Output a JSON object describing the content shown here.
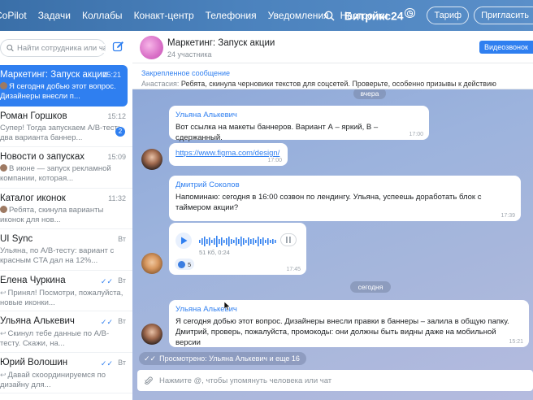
{
  "nav": {
    "items": [
      "CoPilot",
      "Задачи",
      "Коллабы",
      "Конакт-центр",
      "Телефония",
      "Уведомления",
      "Настройки"
    ],
    "logo": "Битрикс24",
    "tariff": "Тариф",
    "invite": "Пригласить"
  },
  "sidebar": {
    "search_placeholder": "Найти сотрудника или чат",
    "chats": [
      {
        "name": "Маркетинг: Запуск акции",
        "time": "15:21",
        "preview": "Я сегодня добью этот вопрос. Дизайнеры внесли п..."
      },
      {
        "name": "Роман Горшков",
        "time": "15:12",
        "preview": "Супер! Тогда запускаем A/B-тест: два варианта баннер...",
        "badge": "2"
      },
      {
        "name": "Новости о запусках",
        "time": "15:09",
        "preview": "В июне — запуск рекламной компании, которая..."
      },
      {
        "name": "Каталог иконок",
        "time": "11:32",
        "preview": "Ребята, скинула варианты иконок для нов..."
      },
      {
        "name": "UI Sync",
        "time": "Вт",
        "preview": "Ульяна, по A/B-тесту: вариант с красным CTA дал на 12%..."
      },
      {
        "name": "Елена Чуркина",
        "time": "Вт",
        "preview": "Принял! Посмотри, пожалуйста, новые иконки..."
      },
      {
        "name": "Ульяна Алькевич",
        "time": "Вт",
        "preview": "Скинул тебе данные по A/B-тесту. Скажи, на..."
      },
      {
        "name": "Юрий Волошин",
        "time": "Вт",
        "preview": "Давай скоординируемся по дизайну для..."
      }
    ]
  },
  "header": {
    "title": "Маркетинг: Запуск акции",
    "members": "24 участника",
    "video_call": "Видеозвонок"
  },
  "pinned": {
    "title": "Закрепленное сообщение",
    "author": "Анастасия:",
    "text": "Ребята, скинула черновики текстов для соцсетей. Проверьте, особенно призывы к действию"
  },
  "messages": {
    "date_yesterday": "вчера",
    "date_today": "сегодня",
    "m1_author": "Ульяна Алькевич",
    "m1_text": "Вот ссылка на макеты баннеров. Вариант А – яркий, В – сдержанный.",
    "m1_time": "17:00",
    "m2_link": "https://www.figma.com/design/",
    "m2_time": "17:00",
    "m3_author": "Дмитрий Соколов",
    "m3_text": "Напоминаю: сегодня в 16:00 созвон по лендингу. Ульяна, успеешь доработать блок с таймером акции?",
    "m3_time": "17:39",
    "audio_meta": "51 Кб,  0:24",
    "audio_reactions": "5",
    "audio_time": "17:45",
    "m4_author": "Ульяна Алькевич",
    "m4_text": "Я сегодня добью этот вопрос. Дизайнеры внесли правки в баннеры – залила в общую папку. Дмитрий, проверь, пожалуйста, промокоды: они должны быть видны даже на мобильной версии",
    "m4_time": "15:21",
    "viewed": "Просмотрено: Ульяна Алькевич и еще 16"
  },
  "composer": {
    "placeholder": "Нажмите @, чтобы упомянуть человека или чат"
  }
}
